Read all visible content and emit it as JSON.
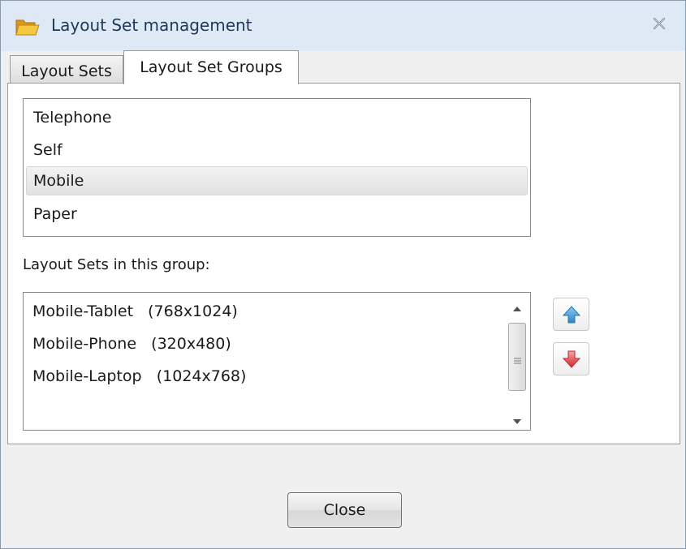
{
  "window": {
    "title": "Layout Set management"
  },
  "tabs": [
    {
      "label": "Layout Sets",
      "active": false
    },
    {
      "label": "Layout Set Groups",
      "active": true
    }
  ],
  "groups": {
    "items": [
      {
        "label": "Telephone",
        "selected": false
      },
      {
        "label": "Self",
        "selected": false
      },
      {
        "label": "Mobile",
        "selected": true
      },
      {
        "label": "Paper",
        "selected": false
      }
    ],
    "selected_label": "Mobile"
  },
  "sets_in_group": {
    "label": "Layout Sets in this group:",
    "items": [
      {
        "name": "Mobile-Tablet   (768x1024)"
      },
      {
        "name": "Mobile-Phone   (320x480)"
      },
      {
        "name": "Mobile-Laptop   (1024x768)"
      }
    ]
  },
  "footer": {
    "close_label": "Close"
  },
  "icons": {
    "title_icon": "folder-open-icon",
    "window_close": "close-icon",
    "move_up": "arrow-up-icon",
    "move_down": "arrow-down-icon"
  },
  "colors": {
    "titlebar": "#dfe9f5",
    "title_text": "#1e395b",
    "arrow_up": "#3d97d4",
    "arrow_down": "#e0404a"
  }
}
